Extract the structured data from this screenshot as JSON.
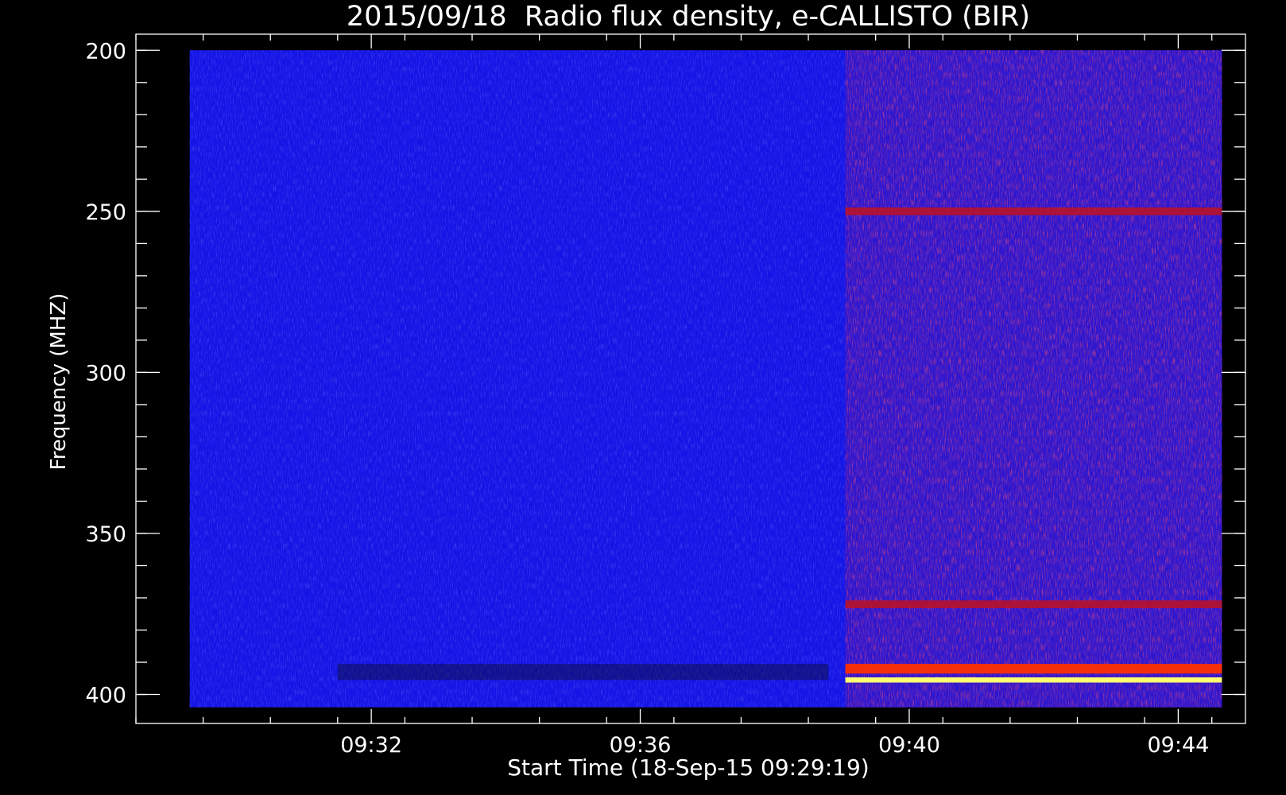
{
  "chart_data": {
    "type": "heatmap",
    "title": "2015/09/18  Radio flux density, e-CALLISTO (BIR)",
    "xlabel": "Start Time (18-Sep-15 09:29:19)",
    "ylabel": "Frequency (MHZ)",
    "x_tick_labels": [
      "09:32",
      "09:36",
      "09:40",
      "09:44"
    ],
    "x_tick_values_min": [
      32,
      36,
      40,
      44
    ],
    "y_tick_labels": [
      "200",
      "250",
      "300",
      "350",
      "400"
    ],
    "y_tick_values": [
      200,
      250,
      300,
      350,
      400
    ],
    "xlim_min": [
      28.5,
      45
    ],
    "ylim": [
      195,
      409
    ],
    "data_x_range_min": [
      29.3,
      44.65
    ],
    "data_y_range": [
      200,
      404
    ],
    "background_level": "low",
    "background_color": "#1414e6",
    "regions": [
      {
        "t_start_min": 39.05,
        "t_end_min": 44.65,
        "f_start": 200,
        "f_end": 404,
        "level": "elevated broadband noise"
      }
    ],
    "bands": [
      {
        "t_start_min": 39.05,
        "t_end_min": 44.65,
        "freq": 250,
        "intensity": "medium"
      },
      {
        "t_start_min": 39.05,
        "t_end_min": 44.65,
        "freq": 372,
        "intensity": "medium"
      },
      {
        "t_start_min": 39.05,
        "t_end_min": 44.65,
        "freq": 392,
        "intensity": "high"
      },
      {
        "t_start_min": 39.05,
        "t_end_min": 44.65,
        "freq": 395.5,
        "intensity": "very high"
      },
      {
        "t_start_min": 31.5,
        "t_end_min": 38.8,
        "freq": 393,
        "intensity": "below background"
      }
    ],
    "colors": {
      "low": "#1414e6",
      "medium": "#c01020",
      "high": "#ff3000",
      "very_high": "#ffff70"
    },
    "grid": false
  }
}
